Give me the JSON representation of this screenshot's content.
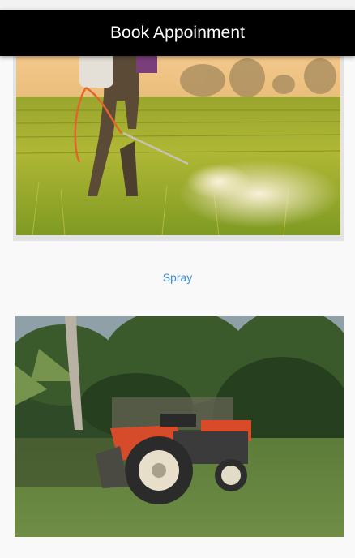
{
  "app_bar": {
    "title": "Book Appoinment"
  },
  "services": [
    {
      "label": "",
      "image": "farmer-spraying-rice-field"
    },
    {
      "label": "Spray",
      "image": "red-tractor-under-palm-trees"
    }
  ],
  "colors": {
    "app_bar_bg": "#000000",
    "link_text": "#3d8fd6",
    "background": "#f9f9f9"
  }
}
